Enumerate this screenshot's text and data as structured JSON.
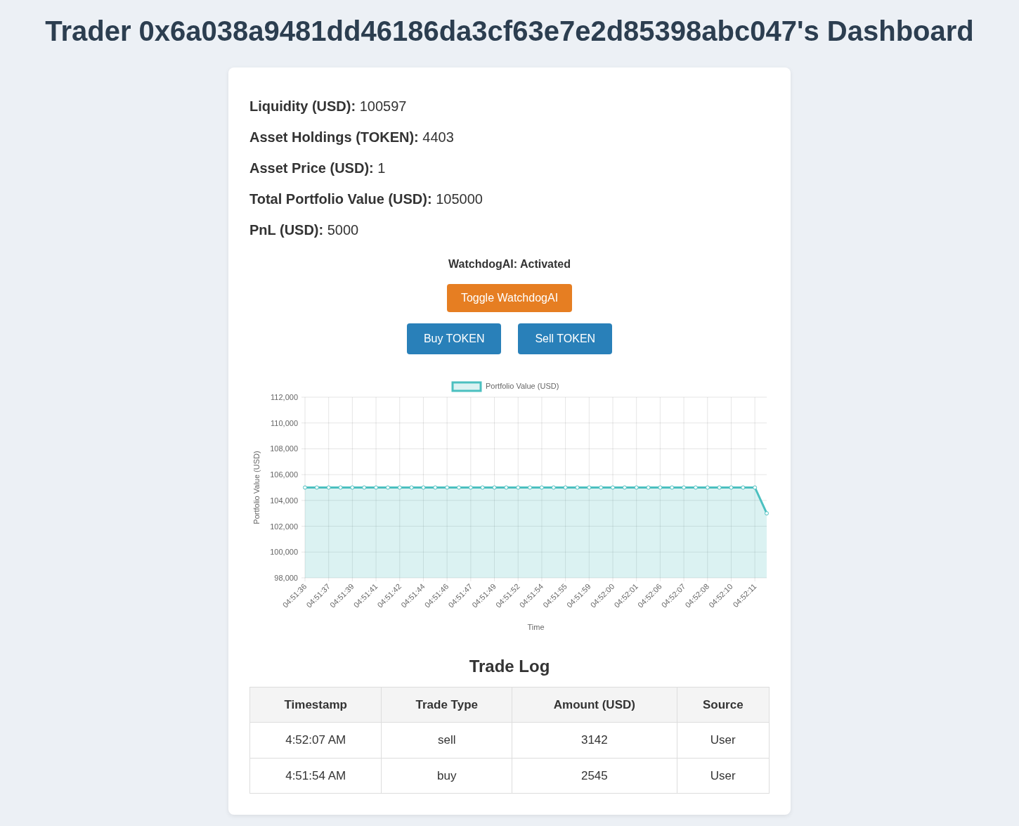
{
  "title": "Trader 0x6a038a9481dd46186da3cf63e7e2d85398abc047's Dashboard",
  "stats": [
    {
      "label": "Liquidity (USD):",
      "value": "100597"
    },
    {
      "label": "Asset Holdings (TOKEN):",
      "value": "4403"
    },
    {
      "label": "Asset Price (USD):",
      "value": "1"
    },
    {
      "label": "Total Portfolio Value (USD):",
      "value": "105000"
    },
    {
      "label": "PnL (USD):",
      "value": "5000"
    }
  ],
  "watchdog": {
    "status": "WatchdogAI: Activated",
    "on": true
  },
  "buttons": [
    {
      "label": "Toggle WatchdogAI",
      "kind": "toggle"
    },
    {
      "label": "Buy TOKEN",
      "kind": "trade"
    },
    {
      "label": "Sell TOKEN",
      "kind": "trade"
    }
  ],
  "chart": {
    "chart_data": {
      "type": "area",
      "grid": true,
      "xlabel": "Time",
      "ylabel": "Portfolio Value (USD)",
      "categories": [
        "04:51:36",
        null,
        "04:51:37",
        null,
        "04:51:39",
        null,
        "04:51:41",
        null,
        "04:51:42",
        null,
        "04:51:44",
        null,
        "04:51:46",
        null,
        "04:51:47",
        null,
        "04:51:49",
        null,
        "04:51:52",
        null,
        "04:51:54",
        null,
        "04:51:55",
        null,
        "04:51:59",
        null,
        "04:52:00",
        null,
        "04:52:01",
        null,
        "04:52:06",
        null,
        "04:52:07",
        null,
        "04:52:08",
        null,
        "04:52:10",
        null,
        "04:52:11",
        null
      ],
      "series": [
        {
          "name": "Portfolio Value (USD)",
          "color": "#4bc0c0",
          "values": [
            105000,
            105000,
            105000,
            105000,
            105000,
            105000,
            105000,
            105000,
            105000,
            105000,
            105000,
            105000,
            105000,
            105000,
            105000,
            105000,
            105000,
            105000,
            105000,
            105000,
            105000,
            105000,
            105000,
            105000,
            105000,
            105000,
            105000,
            105000,
            105000,
            105000,
            105000,
            105000,
            105000,
            105000,
            105000,
            105000,
            105000,
            105000,
            105000,
            103000
          ]
        }
      ],
      "ylim": [
        98000,
        112000
      ],
      "yticks": [
        {
          "value": 98000,
          "label": "98,000"
        },
        {
          "value": 100000,
          "label": "100,000"
        },
        {
          "value": 102000,
          "label": "102,000"
        },
        {
          "value": 104000,
          "label": "104,000"
        },
        {
          "value": 106000,
          "label": "106,000"
        },
        {
          "value": 108000,
          "label": "108,000"
        },
        {
          "value": 110000,
          "label": "110,000"
        },
        {
          "value": 112000,
          "label": "112,000"
        }
      ]
    }
  },
  "trade_log": {
    "title": "Trade Log",
    "columns": [
      "Timestamp",
      "Trade Type",
      "Amount (USD)",
      "Source"
    ],
    "rows": [
      [
        "4:52:07 AM",
        "sell",
        "3142",
        "User"
      ],
      [
        "4:51:54 AM",
        "buy",
        "2545",
        "User"
      ]
    ]
  }
}
